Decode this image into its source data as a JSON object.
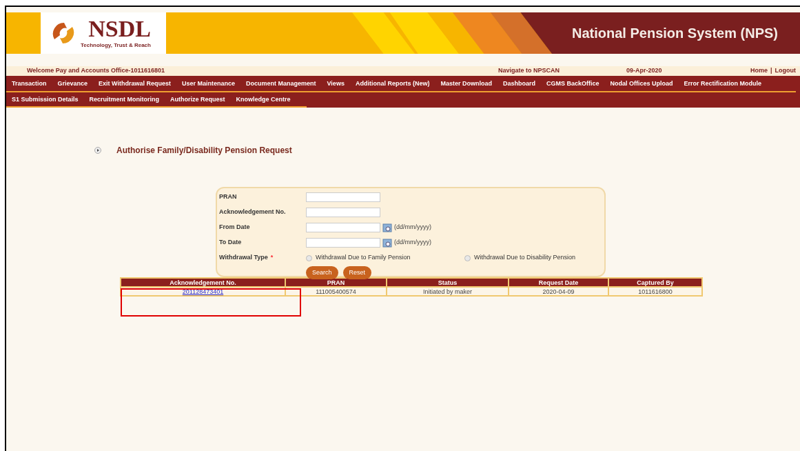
{
  "header": {
    "logo_text": "NSDL",
    "tagline": "Technology, Trust & Reach",
    "title": "National Pension System (NPS)"
  },
  "info_bar": {
    "welcome": "Welcome Pay and Accounts Office-1011616801",
    "navigate": "Navigate to NPSCAN",
    "date": "09-Apr-2020",
    "home": "Home",
    "separator": "|",
    "logout": "Logout"
  },
  "menu_row_1": [
    "Transaction",
    "Grievance",
    "Exit Withdrawal Request",
    "User Maintenance",
    "Document Management",
    "Views",
    "Additional Reports (New)",
    "Master Download",
    "Dashboard",
    "CGMS BackOffice",
    "Nodal Offices Upload",
    "Error Rectification Module"
  ],
  "menu_row_2": [
    "S1 Submission Details",
    "Recruitment Monitoring",
    "Authorize Request",
    "Knowledge Centre"
  ],
  "page_title": "Authorise Family/Disability Pension Request",
  "form": {
    "fields": [
      {
        "label": "PRAN",
        "kind": "text"
      },
      {
        "label": "Acknowledgement No.",
        "kind": "text"
      },
      {
        "label": "From Date",
        "kind": "date",
        "hint": "(dd/mm/yyyy)"
      },
      {
        "label": "To Date",
        "kind": "date",
        "hint": "(dd/mm/yyyy)"
      }
    ],
    "withdrawal_type": {
      "label": "Withdrawal Type",
      "required_mark": "*",
      "options": [
        {
          "label": "Withdrawal Due to Family Pension",
          "selected": false
        },
        {
          "label": "Withdrawal Due to Disability Pension",
          "selected": false
        }
      ]
    },
    "buttons": [
      "Search",
      "Reset"
    ]
  },
  "table": {
    "columns": [
      "Acknowledgement No.",
      "PRAN",
      "Status",
      "Request Date",
      "Captured By"
    ],
    "rows": [
      [
        "201128473401",
        "111005400574",
        "Initiated by maker",
        "2020-04-09",
        "1011616800"
      ]
    ]
  },
  "annotation_box": true
}
